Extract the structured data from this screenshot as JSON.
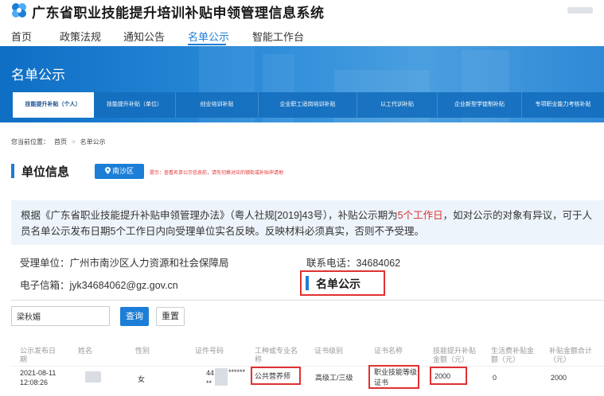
{
  "header": {
    "title": "广东省职业技能提升培训补贴申领管理信息系统"
  },
  "nav": {
    "items": [
      "首页",
      "政策法规",
      "通知公告",
      "名单公示",
      "智能工作台"
    ],
    "active_index": 3
  },
  "banner": {
    "title": "名单公示",
    "tabs": [
      "技能提升补贴（个人）",
      "技能提升补贴（单位）",
      "创业培训补贴",
      "企业职工适岗培训补贴",
      "以工代训补贴",
      "企业新型学徒制补贴",
      "专项职业能力考核补贴"
    ],
    "active_tab": 0
  },
  "breadcrumb": {
    "prefix": "您当前位置：",
    "home": "首页",
    "sep": ">",
    "current": "名单公示"
  },
  "unit_info": {
    "title": "单位信息",
    "region": "南沙区",
    "hint": "提示：查看名单公示信息前，请先切换对应的镇街或补贴申请地"
  },
  "notice": {
    "part1": "根据《广东省职业技能提升补贴申领管理办法》（粤人社规[2019]43号），补贴公示期为",
    "highlight": "5个工作日",
    "part2": "，如对公示的对象有异议，可于人员名单公示发布日期5个工作日内向受理单位实名反映。反映材料必须真实，否则不予受理。"
  },
  "contact": {
    "unit": "受理单位：广州市南沙区人力资源和社会保障局",
    "phone": "联系电话：34684062",
    "email": "电子信箱：jyk34684062@gz.gov.cn"
  },
  "list": {
    "title": "名单公示"
  },
  "search": {
    "value": "梁秋媚",
    "query_label": "查询",
    "reset_label": "重置"
  },
  "table": {
    "headers": [
      "公示发布日期",
      "姓名",
      "性别",
      "证件号码",
      "工种或专业名称",
      "证书级别",
      "证书名称",
      "技能提升补贴金额（元）",
      "生活费补贴金额（元）",
      "补贴金额合计（元）"
    ],
    "rows": [
      {
        "date": "2021-08-11",
        "time": "12:08:26",
        "gender": "女",
        "id_start": "44",
        "id_mask": "******",
        "id_end": "**",
        "occupation": "公共营养师",
        "level": "高级工/三级",
        "cert_line1": "职业技能等级",
        "cert_line2": "证书",
        "skill_subsidy": "2000",
        "living_subsidy": "0",
        "total": "2000"
      }
    ]
  }
}
